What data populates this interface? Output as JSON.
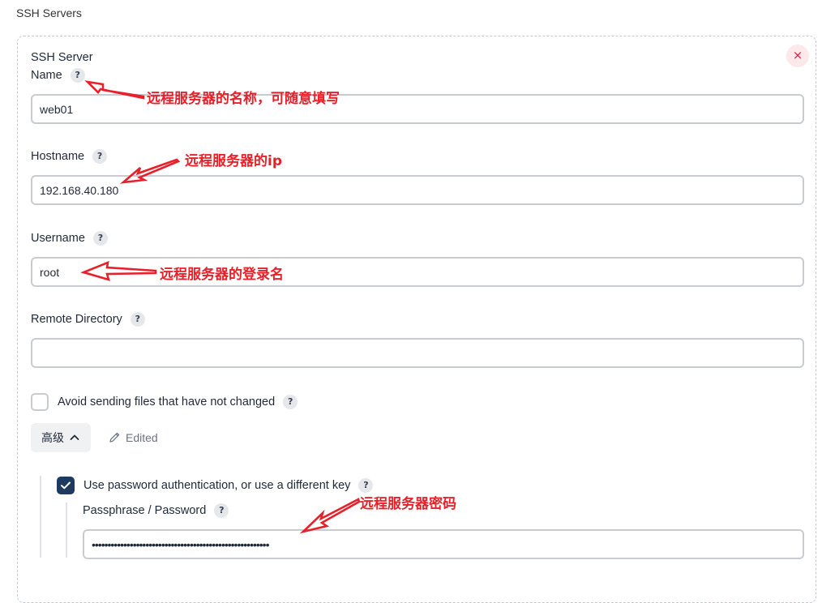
{
  "section_title": "SSH Servers",
  "server": {
    "heading": "SSH Server",
    "close_symbol": "×",
    "name": {
      "label": "Name",
      "value": "web01"
    },
    "hostname": {
      "label": "Hostname",
      "value": "192.168.40.180"
    },
    "username": {
      "label": "Username",
      "value": "root"
    },
    "remote_directory": {
      "label": "Remote Directory",
      "value": ""
    },
    "avoid_sending": {
      "label": "Avoid sending files that have not changed",
      "checked": false
    },
    "advanced": {
      "label": "高级",
      "edited_label": "Edited"
    },
    "use_password": {
      "label": "Use password authentication, or use a different key",
      "checked": true
    },
    "passphrase": {
      "label": "Passphrase / Password",
      "value": "••••••••••••••••••••••••••••••••••••••••••••••••••••••••"
    }
  },
  "help_symbol": "?",
  "annotations": {
    "name": "远程服务器的名称，可随意填写",
    "hostname": "远程服务器的ip",
    "username": "远程服务器的登录名",
    "password": "远程服务器密码"
  },
  "colors": {
    "annotation_red": "#e8202a",
    "checkbox_checked": "#1f3a5f",
    "close_bg": "#fde8ea",
    "close_fg": "#e11d48"
  },
  "icons": {
    "help": "help-icon",
    "close": "close-icon",
    "chevron": "chevron-up-icon",
    "edit": "pencil-icon",
    "check": "checkmark-icon"
  }
}
